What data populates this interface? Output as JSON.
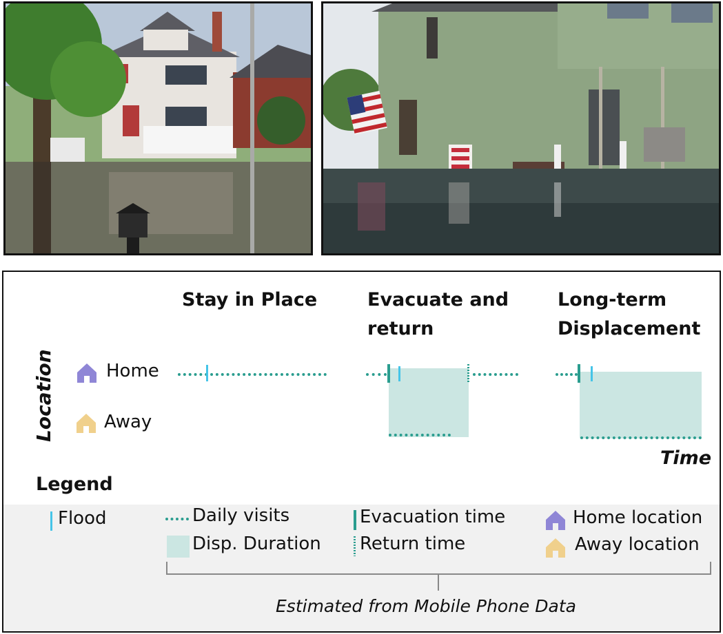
{
  "photos": [
    {
      "description": "flooded street in front of houses"
    },
    {
      "description": "green house with flooded yard"
    }
  ],
  "diagram": {
    "y_axis_label": "Location",
    "x_axis_label": "Time",
    "rows": {
      "home": "Home",
      "away": "Away"
    },
    "scenarios": [
      {
        "title_line1": "Stay in Place",
        "title_line2": ""
      },
      {
        "title_line1": "Evacuate and",
        "title_line2": "return"
      },
      {
        "title_line1": "Long-term",
        "title_line2": "Displacement"
      }
    ]
  },
  "legend": {
    "title": "Legend",
    "flood": "Flood",
    "daily_visits": "Daily visits",
    "disp_duration": "Disp. Duration",
    "evacuation_time": "Evacuation time",
    "return_time": "Return time",
    "home_location": "Home location",
    "away_location": "Away location",
    "footnote": "Estimated from Mobile Phone Data"
  },
  "colors": {
    "daily_visits": "#2a9d8f",
    "flood": "#45c4e8",
    "displacement": "#cbe6e2",
    "home_icon": "#8f86d6",
    "away_icon": "#f0d08c"
  },
  "icons": [
    "home-icon",
    "away-icon"
  ]
}
